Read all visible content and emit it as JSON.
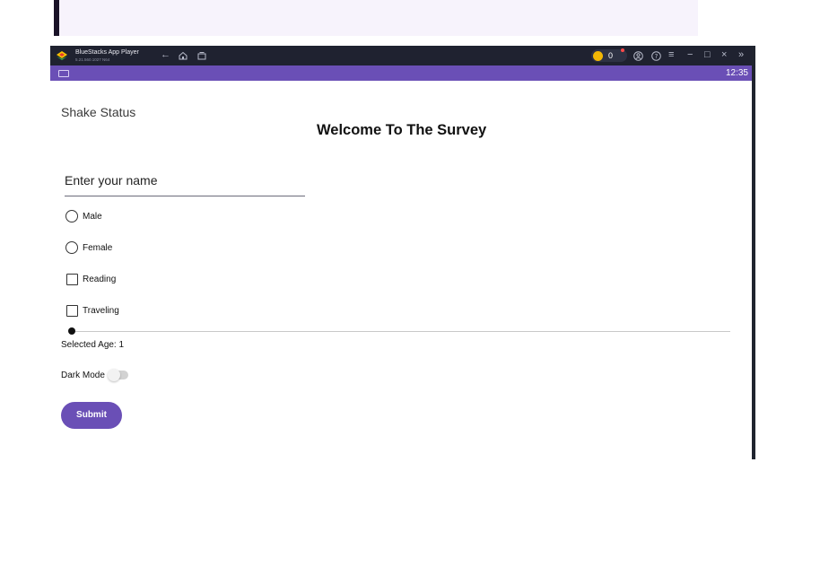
{
  "window": {
    "app_name": "BlueStacks App Player",
    "app_version": "5.21.560.1027  N64",
    "coin_count": "0",
    "time": "12:35"
  },
  "titlebar_icons": {
    "back": "back-arrow-icon",
    "home": "home-icon",
    "recents": "recents-icon",
    "account": "account-icon",
    "help": "help-icon",
    "menu": "menu-icon",
    "minimize": "minimize-icon",
    "maximize": "maximize-icon",
    "close": "close-icon",
    "expand": "expand-sidebar-icon"
  },
  "app": {
    "shake_status": "Shake Status",
    "welcome": "Welcome To The Survey",
    "name_placeholder": "Enter your name",
    "gender_options": [
      "Male",
      "Female"
    ],
    "hobby_options": [
      "Reading",
      "Traveling"
    ],
    "age_label": "Selected Age: 1",
    "age_value": 1,
    "dark_mode_label": "Dark Mode",
    "dark_mode_on": false,
    "submit_label": "Submit"
  },
  "colors": {
    "accent": "#6a4fb6",
    "titlebar": "#1f2230",
    "coin": "#f2b705"
  }
}
